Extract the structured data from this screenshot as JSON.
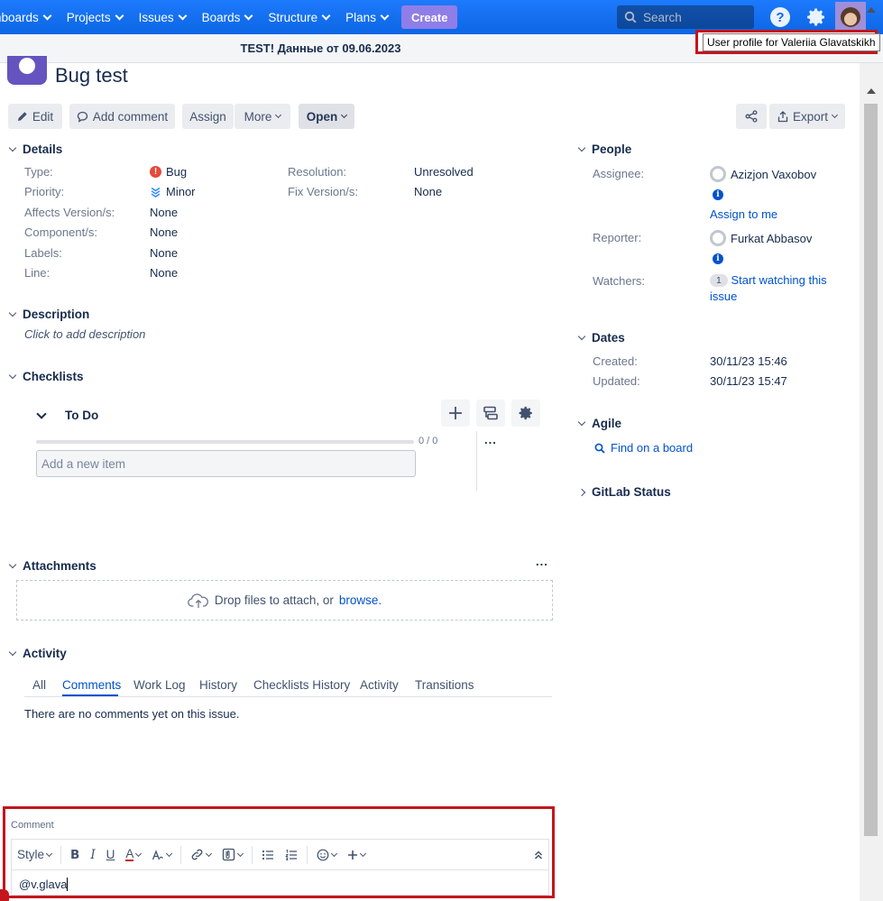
{
  "nav": {
    "items": [
      "hboards",
      "Projects",
      "Issues",
      "Boards",
      "Structure",
      "Plans"
    ],
    "create_label": "Create",
    "search_placeholder": "Search",
    "help_glyph": "?"
  },
  "banner": {
    "text": "TEST! Данные от 09.06.2023"
  },
  "tooltip": {
    "text": "User profile for Valeriia Glavatskikh"
  },
  "issue": {
    "title": "Bug test"
  },
  "toolbar": {
    "edit": "Edit",
    "add_comment": "Add comment",
    "assign": "Assign",
    "more": "More",
    "status": "Open",
    "export": "Export"
  },
  "details": {
    "heading": "Details",
    "type_label": "Type:",
    "type_value": "Bug",
    "priority_label": "Priority:",
    "priority_value": "Minor",
    "affects_label": "Affects Version/s:",
    "affects_value": "None",
    "component_label": "Component/s:",
    "component_value": "None",
    "labels_label": "Labels:",
    "labels_value": "None",
    "line_label": "Line:",
    "line_value": "None",
    "resolution_label": "Resolution:",
    "resolution_value": "Unresolved",
    "fix_label": "Fix Version/s:",
    "fix_value": "None"
  },
  "description": {
    "heading": "Description",
    "placeholder": "Click to add description"
  },
  "checklists": {
    "heading": "Checklists",
    "list_name": "To Do",
    "progress_text": "0 / 0",
    "progress_fraction": 0,
    "input_placeholder": "Add a new item",
    "more_glyph": "..."
  },
  "attachments": {
    "heading": "Attachments",
    "drop_text": "Drop files to attach, or",
    "browse_link": "browse.",
    "more_glyph": "..."
  },
  "activity": {
    "heading": "Activity",
    "tabs": [
      "All",
      "Comments",
      "Work Log",
      "History",
      "Checklists History",
      "Activity",
      "Transitions"
    ],
    "active_tab": "Comments",
    "empty_text": "There are no comments yet on this issue."
  },
  "people": {
    "heading": "People",
    "assignee_label": "Assignee:",
    "assignee_name": "Azizjon Vaxobov",
    "assign_to_me": "Assign to me",
    "reporter_label": "Reporter:",
    "reporter_name": "Furkat Abbasov",
    "watchers_label": "Watchers:",
    "watchers_count": "1",
    "watch_link": "Start watching this issue"
  },
  "dates": {
    "heading": "Dates",
    "created_label": "Created:",
    "created_value": "30/11/23 15:46",
    "updated_label": "Updated:",
    "updated_value": "30/11/23 15:47"
  },
  "agile": {
    "heading": "Agile",
    "find_link": "Find on a board"
  },
  "gitlab": {
    "heading": "GitLab Status"
  },
  "comment": {
    "label": "Comment",
    "style_label": "Style",
    "text": "@v.glava"
  },
  "colors": {
    "nav_bg": "#0c66e4",
    "create_bg": "#8f7ee7",
    "link": "#0052cc",
    "highlight_border": "#c4151c",
    "bug": "#e5493a"
  }
}
